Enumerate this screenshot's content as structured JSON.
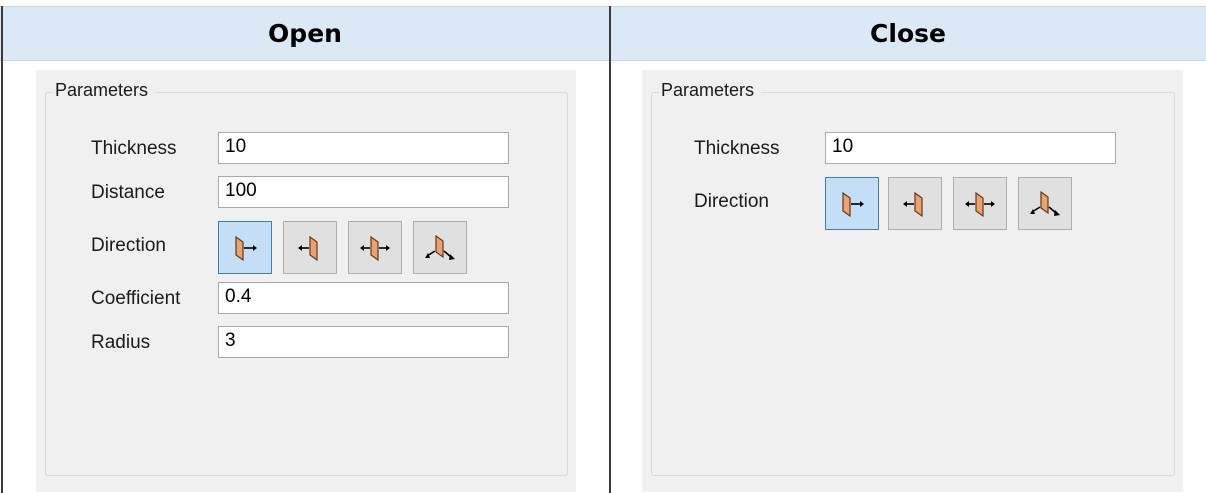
{
  "columns": [
    {
      "header": "Open",
      "group_title": "Parameters",
      "thickness": {
        "label": "Thickness",
        "value": "10"
      },
      "distance": {
        "label": "Distance",
        "value": "100"
      },
      "direction": {
        "label": "Direction",
        "selected_index": 0,
        "options": [
          "one-side-forward-icon",
          "one-side-backward-icon",
          "two-sides-icon",
          "symmetric-icon"
        ]
      },
      "coefficient": {
        "label": "Coefficient",
        "value": "0.4"
      },
      "radius": {
        "label": "Radius",
        "value": "3"
      }
    },
    {
      "header": "Close",
      "group_title": "Parameters",
      "thickness": {
        "label": "Thickness",
        "value": "10"
      },
      "direction": {
        "label": "Direction",
        "selected_index": 0,
        "options": [
          "one-side-forward-icon",
          "one-side-backward-icon",
          "two-sides-icon",
          "symmetric-icon"
        ]
      }
    }
  ],
  "colors": {
    "header_bg": "#dbe9f7",
    "panel_bg": "#f0f0f0",
    "button_active_bg": "#c3def5",
    "button_active_border": "#3c7fb1",
    "icon_fill": "#f0a06a"
  }
}
